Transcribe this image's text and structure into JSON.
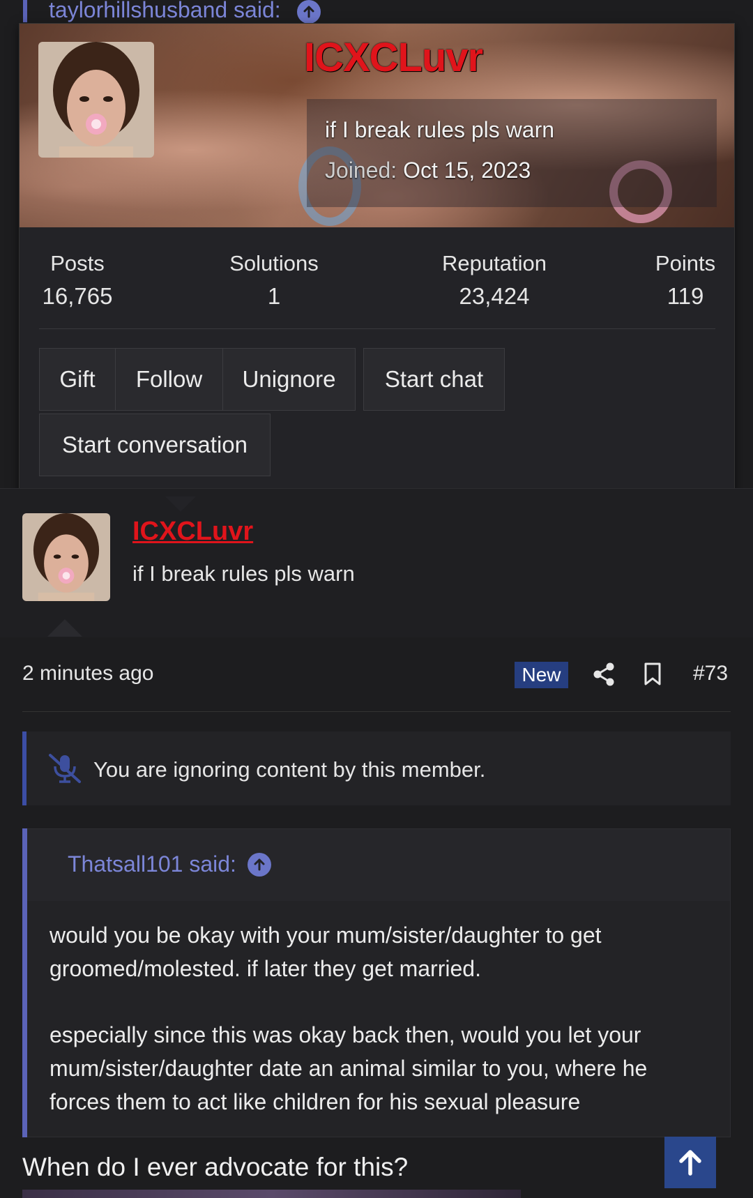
{
  "top_quote": {
    "author_said": "taylorhillshusband said:"
  },
  "member_card": {
    "username": "ICXCLuvr",
    "user_title": "if I break rules pls warn",
    "joined_label": "Joined:",
    "joined_date": "Oct 15, 2023",
    "stats": [
      {
        "label": "Posts",
        "value": "16,765"
      },
      {
        "label": "Solutions",
        "value": "1"
      },
      {
        "label": "Reputation",
        "value": "23,424"
      },
      {
        "label": "Points",
        "value": "119"
      }
    ],
    "buttons": {
      "gift": "Gift",
      "follow": "Follow",
      "unignore": "Unignore",
      "start_chat": "Start chat",
      "start_conversation": "Start conversation"
    }
  },
  "message": {
    "username": "ICXCLuvr",
    "user_title": "if I break rules pls warn",
    "time": "2 minutes ago",
    "new_badge": "New",
    "post_number": "#73",
    "ignored_notice": "You are ignoring content by this member.",
    "quote": {
      "author_said": "Thatsall101 said:",
      "paragraphs": [
        "would you be okay with your mum/sister/daughter to get groomed/molested. if later they get married.",
        "especially since this was okay back then, would you let your mum/sister/daughter date an animal similar to you, where he forces them to act like children for his sexual pleasure"
      ]
    },
    "reply_text": "When do I ever advocate for this?"
  },
  "colors": {
    "background": "#1d1d1f",
    "username_red": "#e0141b",
    "quote_accent": "#5b63b8",
    "new_badge": "#263e80",
    "scroll_top": "#2a478c"
  },
  "icons": [
    "arrow-up-circle-icon",
    "share-icon",
    "bookmark-icon",
    "mic-off-icon",
    "arrow-up-icon"
  ]
}
